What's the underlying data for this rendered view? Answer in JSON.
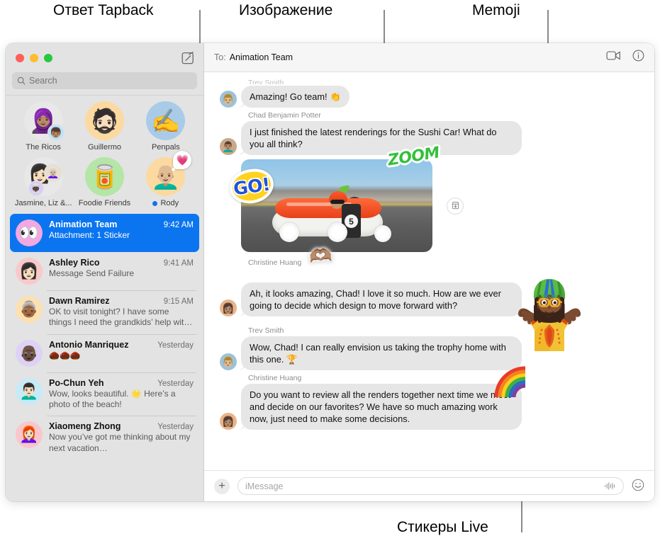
{
  "callouts": [
    {
      "id": "tapback",
      "label": "Ответ Tapback"
    },
    {
      "id": "image",
      "label": "Изображение"
    },
    {
      "id": "memoji",
      "label": "Memoji"
    },
    {
      "id": "live_stickers",
      "label": "Стикеры Live"
    }
  ],
  "window": {
    "traffic_lights": {
      "close": "close-button",
      "minimize": "minimize-button",
      "zoom": "zoom-button"
    },
    "compose_label": "compose-icon"
  },
  "sidebar": {
    "search": {
      "placeholder": "Search",
      "icon": "search-icon"
    },
    "pinned": [
      {
        "name": "The Ricos",
        "avatar_bg": "#e8e8e8",
        "glyph": "🧕🏽",
        "sub_glyph": "👦🏽",
        "sub_bg": "#bfe3f7",
        "badge": null,
        "status_dot": false
      },
      {
        "name": "Guillermo",
        "avatar_bg": "#fcd9a0",
        "glyph": "🧔🏻",
        "sub_glyph": null,
        "sub_bg": null,
        "badge": null,
        "status_dot": false
      },
      {
        "name": "Penpals",
        "avatar_bg": "#a9cbe8",
        "glyph": "✍️",
        "sub_glyph": null,
        "sub_bg": null,
        "badge": null,
        "status_dot": false
      },
      {
        "name": "Jasmine, Liz &...",
        "avatar_bg": "#e8e8e8",
        "glyph": "👩🏻",
        "sub_glyph": "👩🏼‍🦳",
        "sub_bg": "#e7e0cf",
        "badge": null,
        "status_dot": false
      },
      {
        "name": "Foodie Friends",
        "avatar_bg": "#b4e6a6",
        "glyph": "🥫",
        "sub_glyph": null,
        "sub_bg": null,
        "badge": null,
        "status_dot": false
      },
      {
        "name": "Rody",
        "avatar_bg": "#fcd9a0",
        "glyph": "👨🏼‍🦲",
        "sub_glyph": null,
        "sub_bg": null,
        "badge": "💗",
        "status_dot": true
      }
    ],
    "conversations": [
      {
        "name": "Animation Team",
        "time": "9:42 AM",
        "snippet": "Attachment: 1 Sticker",
        "avatar_bg": "#f2a8e0",
        "avatar_glyph": "👀",
        "selected": true
      },
      {
        "name": "Ashley Rico",
        "time": "9:41 AM",
        "snippet": "Message Send Failure",
        "avatar_bg": "#f9c9c9",
        "avatar_glyph": "👩🏻",
        "selected": false
      },
      {
        "name": "Dawn Ramirez",
        "time": "9:15 AM",
        "snippet": "OK to visit tonight? I have some things I need the grandkids’ help with. 🥰",
        "avatar_bg": "#fce0b0",
        "avatar_glyph": "👵🏾",
        "selected": false
      },
      {
        "name": "Antonio Manriquez",
        "time": "Yesterday",
        "snippet": "🌰🌰🌰",
        "avatar_bg": "#ddd2f5",
        "avatar_glyph": "👴🏿",
        "selected": false
      },
      {
        "name": "Po-Chun Yeh",
        "time": "Yesterday",
        "snippet": "Wow, looks beautiful. 🌟 Here’s a photo of the beach!",
        "avatar_bg": "#c7eaf7",
        "avatar_glyph": "👨🏻‍🦱",
        "selected": false
      },
      {
        "name": "Xiaomeng Zhong",
        "time": "Yesterday",
        "snippet": "Now you’ve got me thinking about my next vacation…",
        "avatar_bg": "#f9c6cc",
        "avatar_glyph": "👩🏻‍🦰",
        "selected": false
      }
    ]
  },
  "thread": {
    "to_label": "To:",
    "to_value": "Animation Team",
    "actions": [
      {
        "name": "facetime-video-icon"
      },
      {
        "name": "info-icon"
      }
    ],
    "messages": [
      {
        "type": "text",
        "sender": "Trev Smith",
        "show_sender": true,
        "text": "Amazing! Go team! 👏",
        "avatar_bg": "#9ec2d6",
        "avatar_glyph": "👨🏼"
      },
      {
        "type": "text",
        "sender": "Chad Benjamin Potter",
        "show_sender": true,
        "text": "I just finished the latest renderings for the Sushi Car! What do you all think?",
        "avatar_bg": "#c9a98a",
        "avatar_glyph": "👨🏽‍🦱"
      },
      {
        "type": "image",
        "sender": "",
        "show_sender": false,
        "alt": "Sushi race car rendering",
        "car_number": "5",
        "stickers": [
          {
            "name": "go-sticker",
            "text": "GO!"
          },
          {
            "name": "zoom-sticker",
            "text": "ZOOM"
          },
          {
            "name": "heart-hands-sticker",
            "text": "🫶🏽"
          }
        ],
        "save_icon": "save-to-downloads-icon",
        "avatar_bg": "#c9a98a",
        "avatar_glyph": "👨🏽‍🦱"
      },
      {
        "type": "text",
        "sender": "Christine Huang",
        "show_sender": true,
        "text": "Ah, it looks amazing, Chad! I love it so much. How are we ever going to decide which design to move forward with?",
        "avatar_bg": "#e8b48a",
        "avatar_glyph": "👩🏽"
      },
      {
        "type": "text",
        "sender": "Trev Smith",
        "show_sender": true,
        "text": "Wow, Chad! I can really envision us taking the trophy home with this one. 🏆",
        "avatar_bg": "#9ec2d6",
        "avatar_glyph": "👨🏼"
      },
      {
        "type": "text",
        "sender": "Christine Huang",
        "show_sender": true,
        "text": "Do you want to review all the renders together next time we meet and decide on our favorites? We have so much amazing work now, just need to make some decisions.",
        "avatar_bg": "#e8b48a",
        "avatar_glyph": "👩🏽"
      }
    ],
    "composer": {
      "plus_label": "+",
      "placeholder": "iMessage",
      "audio_icon": "audio-message-icon",
      "emoji_icon": "emoji-picker-icon",
      "emoji_glyph": "😀"
    }
  },
  "overlays": {
    "memoji": {
      "name": "memoji-shrug-character"
    },
    "rainbow": {
      "name": "rainbow-live-sticker"
    }
  },
  "colors": {
    "accent_selected": "#0b75f0",
    "sidebar_bg": "#e3e3e3",
    "bubble_bg": "#e6e6e6",
    "status_dot": "#1272ec"
  }
}
